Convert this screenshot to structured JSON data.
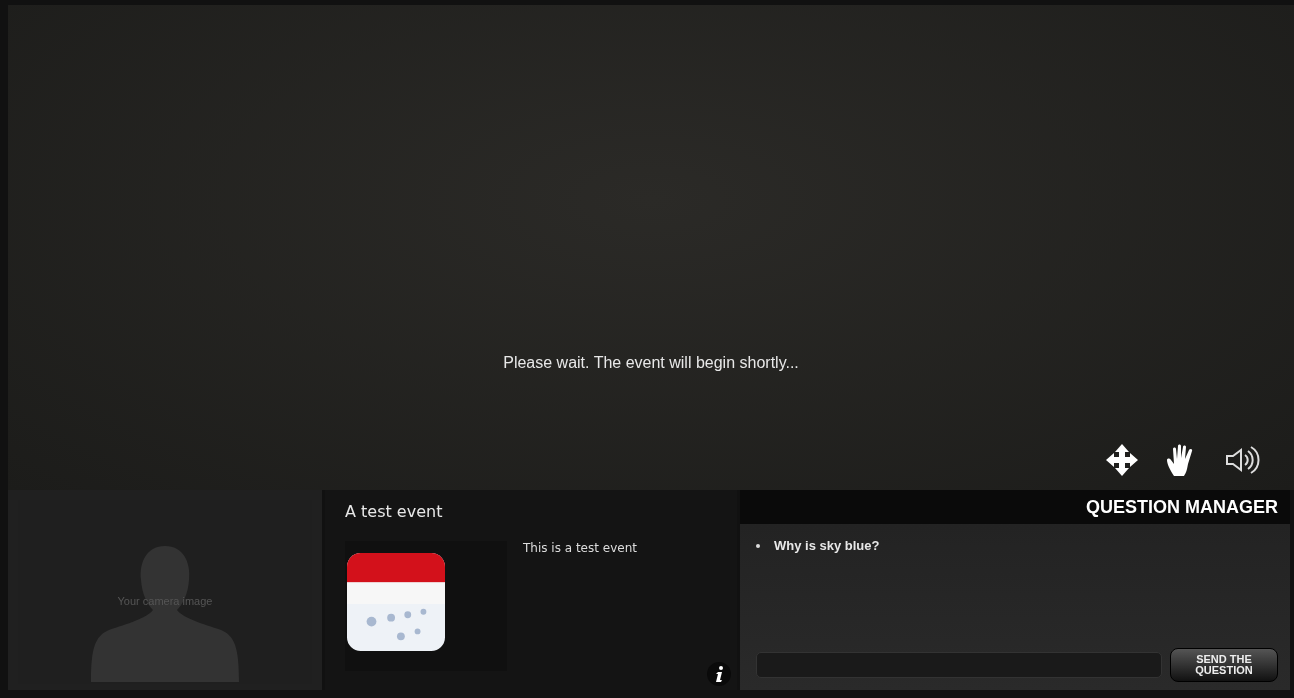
{
  "stage": {
    "message": "Please wait. The event will begin shortly..."
  },
  "camera": {
    "label": "Your camera image"
  },
  "event": {
    "title": "A test event",
    "description": "This is a test event"
  },
  "question_manager": {
    "title": "QUESTION MANAGER",
    "questions": [
      "Why is sky blue?"
    ],
    "send_button": "SEND THE QUESTION"
  }
}
